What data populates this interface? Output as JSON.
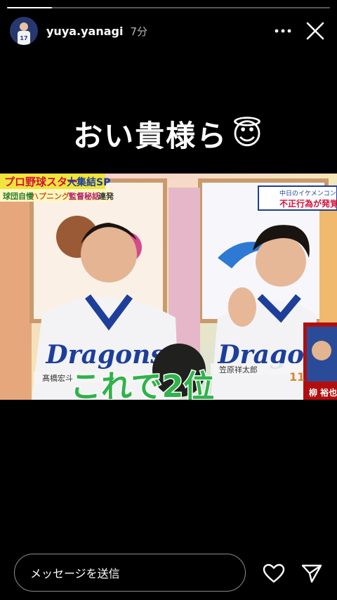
{
  "story": {
    "progress": 0.14
  },
  "header": {
    "username": "yuya.yanagi",
    "time_ago": "7分"
  },
  "caption": {
    "text": "おい貴様ら",
    "emoji": "😇"
  },
  "tv_overlay": {
    "program_title_1": "プロ野球スター",
    "program_title_2": "大集結SP",
    "program_subtitle_1": "球団自慢",
    "program_subtitle_2": "ハプニング",
    "program_subtitle_3": "監督秘話",
    "program_subtitle_4": "連発",
    "corner_title": "中日のイケメンコン",
    "corner_subtitle": "不正行為が発覚",
    "left_player_name": "髙橋宏斗",
    "right_player_name": "笠原祥太郎",
    "right_player_number": "11",
    "team_logo": "Dragons",
    "big_caption": "これで2位",
    "inset_name": "柳 裕也"
  },
  "footer": {
    "message_placeholder": "メッセージを送信"
  },
  "colors": {
    "background": "#000000",
    "text": "#ffffff",
    "dragons_blue": "#1d3f9a",
    "caption_green": "#2fb34a"
  },
  "icons": {
    "more": "more-horizontal-icon",
    "close": "close-icon",
    "like": "heart-icon",
    "send": "send-icon"
  }
}
